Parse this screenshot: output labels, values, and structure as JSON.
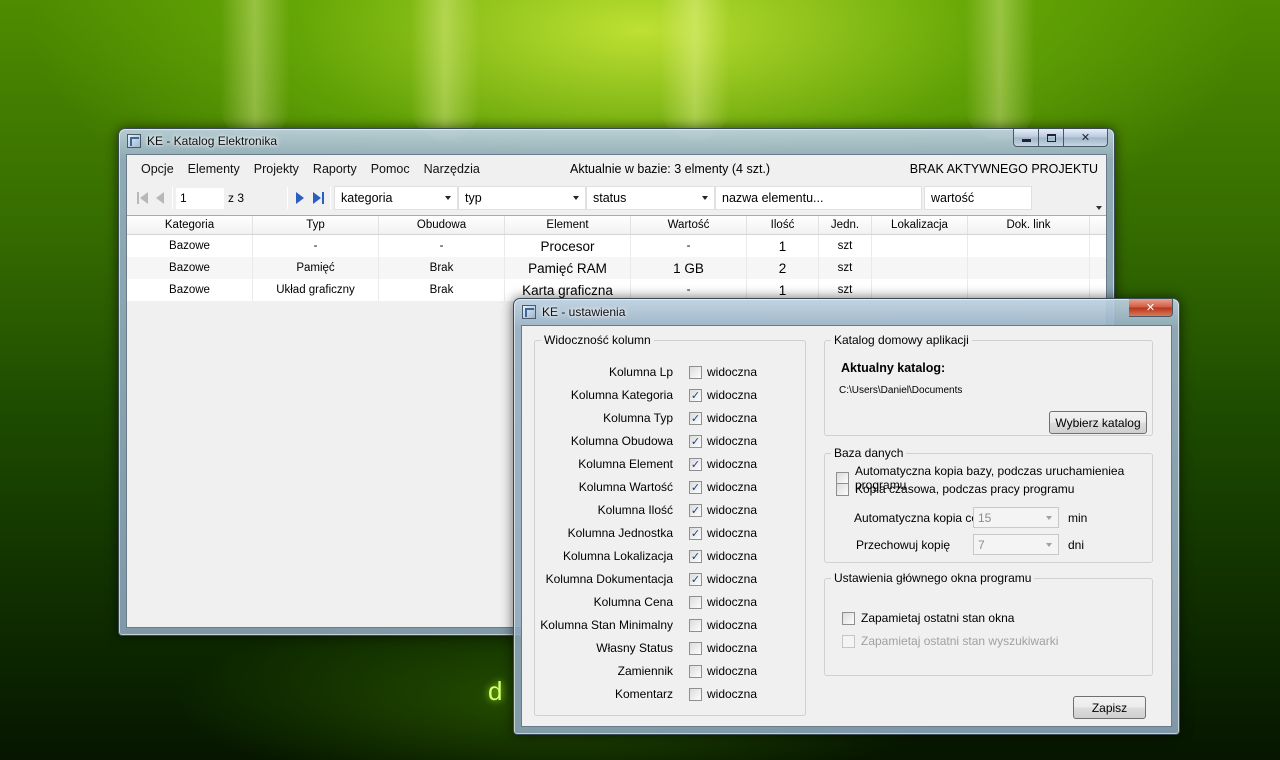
{
  "desktop": {
    "glyph": "d"
  },
  "main_window": {
    "title": "KE - Katalog Elektronika",
    "menu": [
      "Opcje",
      "Elementy",
      "Projekty",
      "Raporty",
      "Pomoc",
      "Narzędzia"
    ],
    "db_status": "Aktualnie w bazie: 3 elmenty (4 szt.)",
    "project_status": "BRAK AKTYWNEGO PROJEKTU",
    "toolbar": {
      "page": "1",
      "page_of": "z 3",
      "filter_category": "kategoria",
      "filter_type": "typ",
      "filter_status": "status",
      "search_name": "nazwa elementu...",
      "search_value": "wartość"
    },
    "grid": {
      "columns": [
        "Kategoria",
        "Typ",
        "Obudowa",
        "Element",
        "Wartość",
        "Ilość",
        "Jedn.",
        "Lokalizacja",
        "Dok. link"
      ],
      "rows": [
        [
          "Bazowe",
          "-",
          "-",
          "Procesor",
          "-",
          "1",
          "szt",
          "",
          ""
        ],
        [
          "Bazowe",
          "Pamięć",
          "Brak",
          "Pamięć RAM",
          "1 GB",
          "2",
          "szt",
          "",
          ""
        ],
        [
          "Bazowe",
          "Układ graficzny",
          "Brak",
          "Karta graficzna",
          "-",
          "1",
          "szt",
          "",
          ""
        ]
      ]
    }
  },
  "settings": {
    "title": "KE - ustawienia",
    "columns_group": "Widoczność kolumn",
    "visible_label": "widoczna",
    "columns": [
      {
        "label": "Kolumna Lp",
        "checked": false
      },
      {
        "label": "Kolumna Kategoria",
        "checked": true
      },
      {
        "label": "Kolumna Typ",
        "checked": true
      },
      {
        "label": "Kolumna Obudowa",
        "checked": true
      },
      {
        "label": "Kolumna Element",
        "checked": true
      },
      {
        "label": "Kolumna Wartość",
        "checked": true
      },
      {
        "label": "Kolumna Ilość",
        "checked": true
      },
      {
        "label": "Kolumna Jednostka",
        "checked": true
      },
      {
        "label": "Kolumna Lokalizacja",
        "checked": true
      },
      {
        "label": "Kolumna Dokumentacja",
        "checked": true
      },
      {
        "label": "Kolumna Cena",
        "checked": false
      },
      {
        "label": "Kolumna Stan Minimalny",
        "checked": false
      },
      {
        "label": "Własny Status",
        "checked": false
      },
      {
        "label": "Zamiennik",
        "checked": false
      },
      {
        "label": "Komentarz",
        "checked": false
      }
    ],
    "catalog_group": "Katalog domowy aplikacji",
    "catalog_label": "Aktualny katalog:",
    "catalog_path": "C:\\Users\\Daniel\\Documents",
    "choose_catalog": "Wybierz katalog",
    "db_group": "Baza danych",
    "auto_backup": {
      "label": "Automatyczna kopia bazy, podczas uruchamieniea programu",
      "checked": false
    },
    "temp_backup": {
      "label": "Kopia czasowa, podczas pracy programu",
      "checked": false
    },
    "auto_every_label": "Automatyczna kopia co",
    "auto_every_value": "15",
    "auto_every_unit": "min",
    "keep_label": "Przechowuj kopię",
    "keep_value": "7",
    "keep_unit": "dni",
    "window_group": "Ustawienia głównego okna programu",
    "remember_window": {
      "label": "Zapamietaj ostatni stan okna",
      "checked": false
    },
    "remember_search": {
      "label": "Zapamietaj ostatni stan wyszukiwarki",
      "checked": false,
      "disabled": true
    },
    "save_button": "Zapisz"
  },
  "colors": {
    "desktop_green": "#356c00",
    "nav_blue": "#2a5fc0",
    "close_red": "#c8452b",
    "check_blue": "#1f3f86"
  }
}
